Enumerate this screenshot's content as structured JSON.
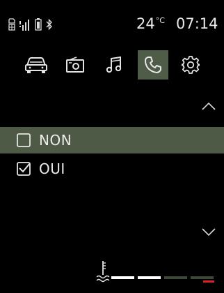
{
  "status": {
    "temperature_value": "24",
    "temperature_unit": "°C",
    "time": "07:14",
    "icons": [
      "sim-card-icon",
      "signal-strength-icon",
      "phone-battery-icon",
      "bluetooth-icon"
    ]
  },
  "tabs": [
    {
      "id": "vehicle",
      "icon": "car-icon",
      "active": false
    },
    {
      "id": "radio",
      "icon": "radio-icon",
      "active": false
    },
    {
      "id": "media",
      "icon": "music-note-icon",
      "active": false
    },
    {
      "id": "phone",
      "icon": "phone-icon",
      "active": true
    },
    {
      "id": "settings",
      "icon": "gear-icon",
      "active": false
    }
  ],
  "list": {
    "items": [
      {
        "label": "NON",
        "checked": false,
        "selected": true
      },
      {
        "label": "OUI",
        "checked": true,
        "selected": false
      }
    ],
    "scroll_up_icon": "chevron-up-icon",
    "scroll_down_icon": "chevron-down-icon"
  },
  "coolant_gauge": {
    "icon": "coolant-temperature-icon",
    "segments": 4,
    "lit_segments": 2,
    "level_fraction": 0.5,
    "colors": {
      "lit": "#ffffff",
      "unlit": "#3e4838",
      "warning": "#d6242a"
    }
  },
  "colors": {
    "background": "#000000",
    "highlight": "#4e5a45",
    "text": "#ececec"
  }
}
